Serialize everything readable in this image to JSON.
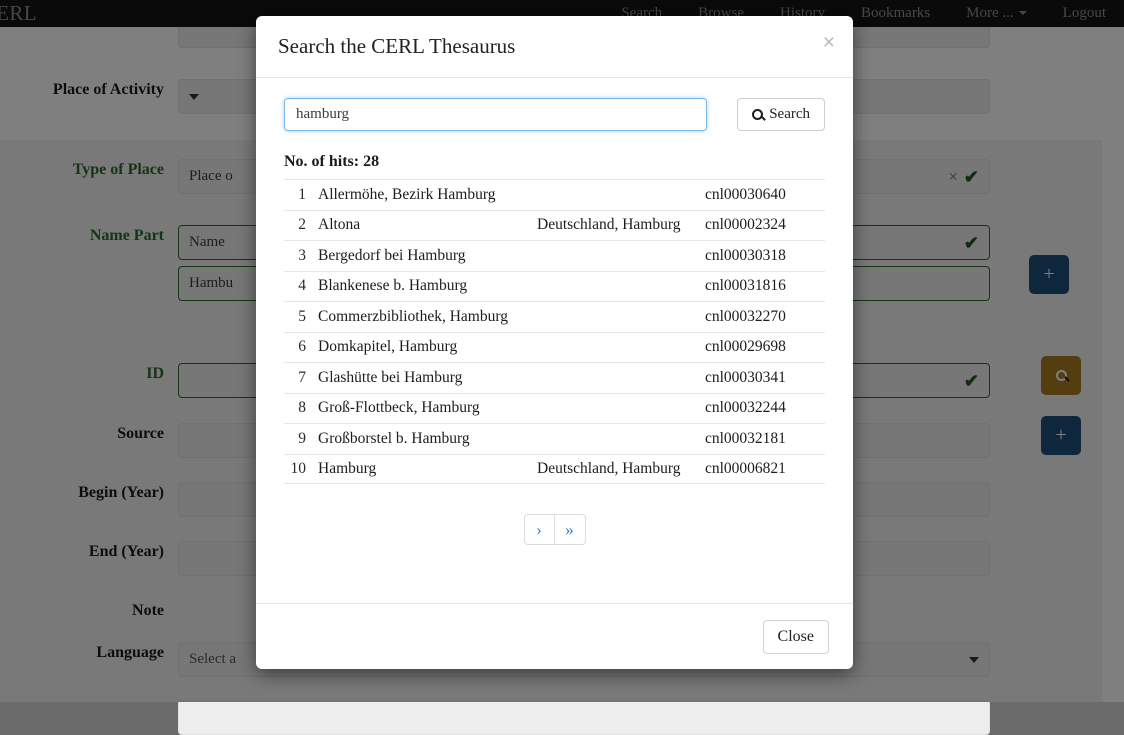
{
  "navbar": {
    "brand": "CERL",
    "items": [
      {
        "label": "Search"
      },
      {
        "label": "Browse"
      },
      {
        "label": "History"
      },
      {
        "label": "Bookmarks"
      },
      {
        "label": "More ..."
      },
      {
        "label": "Logout"
      }
    ]
  },
  "form": {
    "rows": [
      {
        "label": "Place of Activity",
        "value": ""
      },
      {
        "label": "Type of Place",
        "value": "Place o"
      },
      {
        "label": "Name Part",
        "value": "Name"
      },
      {
        "label": "",
        "value": "Hambu"
      },
      {
        "label": "ID",
        "value": ""
      },
      {
        "label": "Source",
        "value": ""
      },
      {
        "label": "Begin (Year)",
        "value": ""
      },
      {
        "label": "End (Year)",
        "value": ""
      },
      {
        "label": "Note",
        "value": ""
      },
      {
        "label": "Language",
        "value": "Select a"
      }
    ],
    "icons": {
      "clear": "×",
      "check": "✔",
      "plus": "+",
      "search": "search-icon"
    }
  },
  "modal": {
    "title": "Search the CERL Thesaurus",
    "close_icon": "×",
    "search": {
      "value": "hamburg",
      "placeholder": "",
      "button_label": "Search"
    },
    "hits_label": "No. of hits: 28",
    "hits_count": 28,
    "results": [
      {
        "num": "1",
        "name": "Allermöhe, Bezirk Hamburg",
        "location": "",
        "id": "cnl00030640"
      },
      {
        "num": "2",
        "name": "Altona",
        "location": "Deutschland, Hamburg",
        "id": "cnl00002324"
      },
      {
        "num": "3",
        "name": "Bergedorf bei Hamburg",
        "location": "",
        "id": "cnl00030318"
      },
      {
        "num": "4",
        "name": "Blankenese b. Hamburg",
        "location": "",
        "id": "cnl00031816"
      },
      {
        "num": "5",
        "name": "Commerzbibliothek, Hamburg",
        "location": "",
        "id": "cnl00032270"
      },
      {
        "num": "6",
        "name": "Domkapitel, Hamburg",
        "location": "",
        "id": "cnl00029698"
      },
      {
        "num": "7",
        "name": "Glashütte bei Hamburg",
        "location": "",
        "id": "cnl00030341"
      },
      {
        "num": "8",
        "name": "Groß-Flottbeck, Hamburg",
        "location": "",
        "id": "cnl00032244"
      },
      {
        "num": "9",
        "name": "Großborstel b. Hamburg",
        "location": "",
        "id": "cnl00032181"
      },
      {
        "num": "10",
        "name": "Hamburg",
        "location": "Deutschland, Hamburg",
        "id": "cnl00006821"
      }
    ],
    "pagination": {
      "next_label": "›",
      "last_label": "»"
    },
    "footer": {
      "close_label": "Close"
    }
  },
  "colors": {
    "navbar_bg": "#141414",
    "accent_blue": "#1f4e79",
    "accent_gold": "#a97d21",
    "label_green": "#2d6a2d",
    "link_blue": "#3c7fc4"
  }
}
